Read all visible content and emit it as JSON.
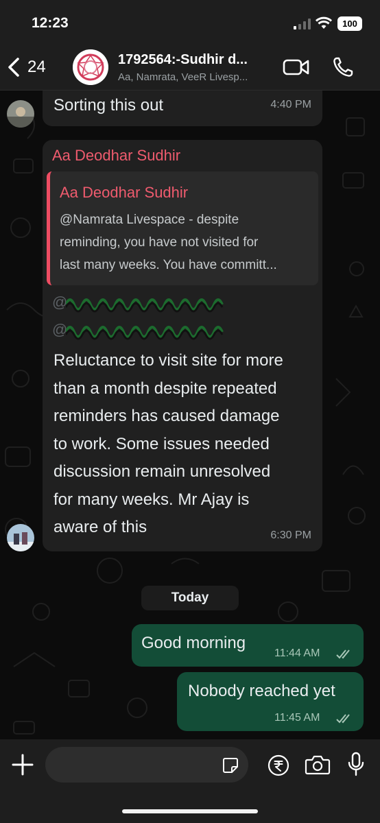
{
  "status_bar": {
    "time": "12:23",
    "battery": "100"
  },
  "header": {
    "back_count": "24",
    "group_name": "1792564:-Sudhir d...",
    "participants": "Aa, Namrata, VeeR Livesp..."
  },
  "messages": [
    {
      "direction": "incoming",
      "text": "Sorting this out",
      "time": "4:40 PM"
    },
    {
      "direction": "incoming",
      "sender": "Aa Deodhar Sudhir",
      "quote": {
        "sender": "Aa Deodhar Sudhir",
        "lines": [
          "@Namrata Livespace - despite",
          "reminding, you have not visited for",
          "last many weeks. You have committ..."
        ]
      },
      "mentions": [
        "@",
        "@"
      ],
      "lines": [
        "Reluctance to visit site for more",
        "than a month despite repeated",
        "reminders has caused damage",
        "to work. Some issues needed",
        "discussion remain unresolved",
        "for many weeks. Mr Ajay is",
        "aware of this"
      ],
      "time": "6:30 PM"
    },
    {
      "direction": "outgoing",
      "text": "Good morning",
      "time": "11:44 AM",
      "status": "read"
    },
    {
      "direction": "outgoing",
      "text": "Nobody reached yet",
      "time": "11:45 AM",
      "status": "read"
    }
  ],
  "date_separator": "Today",
  "input": {
    "placeholder": ""
  },
  "colors": {
    "outgoing_bubble": "#134d37",
    "incoming_bubble": "#202020",
    "sender_name": "#ef5b6e",
    "read_tick": "#a9c7b8"
  },
  "icons": [
    "back-chevron-icon",
    "video-call-icon",
    "phone-icon",
    "plus-icon",
    "sticker-icon",
    "rupee-icon",
    "camera-icon",
    "mic-icon",
    "double-tick-icon"
  ]
}
